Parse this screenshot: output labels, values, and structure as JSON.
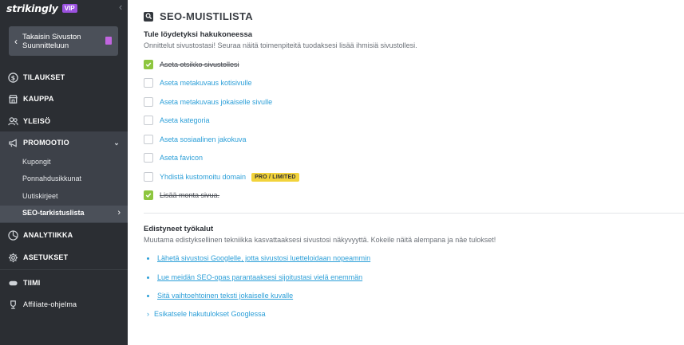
{
  "sidebar": {
    "logo": "strikingly",
    "vip_badge": "VIP",
    "back_label": "Takaisin Sivuston\nSuunnitteluun",
    "nav": {
      "orders": "TILAUKSET",
      "store": "KAUPPA",
      "audience": "YLEISÖ",
      "promotion": "PROMOOTIO",
      "analytics": "ANALYTIIKKA",
      "settings": "ASETUKSET",
      "team": "TIIMI",
      "affiliate": "Affiliate-ohjelma"
    },
    "promotion_sub": {
      "coupons": "Kupongit",
      "popups": "Ponnahdusikkunat",
      "newsletters": "Uutiskirjeet",
      "seo": "SEO-tarkistuslista"
    }
  },
  "main": {
    "title": "SEO-MUISTILISTA",
    "section1": {
      "heading": "Tule löydetyksi hakukoneessa",
      "desc": "Onnittelut sivustostasi! Seuraa näitä toimenpiteitä tuodaksesi lisää ihmisiä sivustollesi.",
      "items": {
        "title": {
          "label": "Aseta otsikko sivustollesi",
          "checked": true
        },
        "meta_home": {
          "label": "Aseta metakuvaus kotisivulle",
          "checked": false
        },
        "meta_each": {
          "label": "Aseta metakuvaus jokaiselle sivulle",
          "checked": false
        },
        "category": {
          "label": "Aseta kategoria",
          "checked": false
        },
        "social": {
          "label": "Aseta sosiaalinen jakokuva",
          "checked": false
        },
        "favicon": {
          "label": "Aseta favicon",
          "checked": false
        },
        "domain": {
          "label": "Yhdistä kustomoitu domain",
          "checked": false,
          "badge": "PRO / LIMITED"
        },
        "pages": {
          "label": "Lisää monta sivua.",
          "checked": true
        }
      }
    },
    "section2": {
      "heading": "Edistyneet työkalut",
      "desc": "Muutama edistyksellinen tekniikka kasvattaaksesi sivustosi näkyvyyttä. Kokeile näitä alempana ja näe tulokset!",
      "links": {
        "google": "Lähetä sivustosi Googlelle, jotta sivustosi luetteloidaan nopeammin",
        "guide": "Lue meidän SEO-opas parantaaksesi sijoitustasi vielä enemmän",
        "alt": "Sitä vaihtoehtoinen teksti jokaiselle kuvalle"
      },
      "preview": "Esikatsele hakutulokset Googlessa"
    }
  },
  "colors": {
    "sidebar_bg": "#2b2e33",
    "accent_link": "#2c9fd8",
    "check_green": "#8dc63f",
    "vip_purple": "#9b51e0",
    "badge_yellow": "#f2d33b"
  }
}
